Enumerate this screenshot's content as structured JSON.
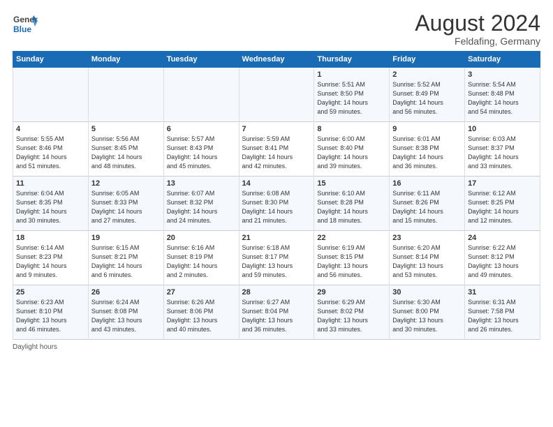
{
  "header": {
    "logo_general": "General",
    "logo_blue": "Blue",
    "month_title": "August 2024",
    "subtitle": "Feldafing, Germany"
  },
  "footer": {
    "note": "Daylight hours"
  },
  "days_of_week": [
    "Sunday",
    "Monday",
    "Tuesday",
    "Wednesday",
    "Thursday",
    "Friday",
    "Saturday"
  ],
  "weeks": [
    {
      "cells": [
        {
          "day": "",
          "info": ""
        },
        {
          "day": "",
          "info": ""
        },
        {
          "day": "",
          "info": ""
        },
        {
          "day": "",
          "info": ""
        },
        {
          "day": "1",
          "info": "Sunrise: 5:51 AM\nSunset: 8:50 PM\nDaylight: 14 hours\nand 59 minutes."
        },
        {
          "day": "2",
          "info": "Sunrise: 5:52 AM\nSunset: 8:49 PM\nDaylight: 14 hours\nand 56 minutes."
        },
        {
          "day": "3",
          "info": "Sunrise: 5:54 AM\nSunset: 8:48 PM\nDaylight: 14 hours\nand 54 minutes."
        }
      ]
    },
    {
      "cells": [
        {
          "day": "4",
          "info": "Sunrise: 5:55 AM\nSunset: 8:46 PM\nDaylight: 14 hours\nand 51 minutes."
        },
        {
          "day": "5",
          "info": "Sunrise: 5:56 AM\nSunset: 8:45 PM\nDaylight: 14 hours\nand 48 minutes."
        },
        {
          "day": "6",
          "info": "Sunrise: 5:57 AM\nSunset: 8:43 PM\nDaylight: 14 hours\nand 45 minutes."
        },
        {
          "day": "7",
          "info": "Sunrise: 5:59 AM\nSunset: 8:41 PM\nDaylight: 14 hours\nand 42 minutes."
        },
        {
          "day": "8",
          "info": "Sunrise: 6:00 AM\nSunset: 8:40 PM\nDaylight: 14 hours\nand 39 minutes."
        },
        {
          "day": "9",
          "info": "Sunrise: 6:01 AM\nSunset: 8:38 PM\nDaylight: 14 hours\nand 36 minutes."
        },
        {
          "day": "10",
          "info": "Sunrise: 6:03 AM\nSunset: 8:37 PM\nDaylight: 14 hours\nand 33 minutes."
        }
      ]
    },
    {
      "cells": [
        {
          "day": "11",
          "info": "Sunrise: 6:04 AM\nSunset: 8:35 PM\nDaylight: 14 hours\nand 30 minutes."
        },
        {
          "day": "12",
          "info": "Sunrise: 6:05 AM\nSunset: 8:33 PM\nDaylight: 14 hours\nand 27 minutes."
        },
        {
          "day": "13",
          "info": "Sunrise: 6:07 AM\nSunset: 8:32 PM\nDaylight: 14 hours\nand 24 minutes."
        },
        {
          "day": "14",
          "info": "Sunrise: 6:08 AM\nSunset: 8:30 PM\nDaylight: 14 hours\nand 21 minutes."
        },
        {
          "day": "15",
          "info": "Sunrise: 6:10 AM\nSunset: 8:28 PM\nDaylight: 14 hours\nand 18 minutes."
        },
        {
          "day": "16",
          "info": "Sunrise: 6:11 AM\nSunset: 8:26 PM\nDaylight: 14 hours\nand 15 minutes."
        },
        {
          "day": "17",
          "info": "Sunrise: 6:12 AM\nSunset: 8:25 PM\nDaylight: 14 hours\nand 12 minutes."
        }
      ]
    },
    {
      "cells": [
        {
          "day": "18",
          "info": "Sunrise: 6:14 AM\nSunset: 8:23 PM\nDaylight: 14 hours\nand 9 minutes."
        },
        {
          "day": "19",
          "info": "Sunrise: 6:15 AM\nSunset: 8:21 PM\nDaylight: 14 hours\nand 6 minutes."
        },
        {
          "day": "20",
          "info": "Sunrise: 6:16 AM\nSunset: 8:19 PM\nDaylight: 14 hours\nand 2 minutes."
        },
        {
          "day": "21",
          "info": "Sunrise: 6:18 AM\nSunset: 8:17 PM\nDaylight: 13 hours\nand 59 minutes."
        },
        {
          "day": "22",
          "info": "Sunrise: 6:19 AM\nSunset: 8:15 PM\nDaylight: 13 hours\nand 56 minutes."
        },
        {
          "day": "23",
          "info": "Sunrise: 6:20 AM\nSunset: 8:14 PM\nDaylight: 13 hours\nand 53 minutes."
        },
        {
          "day": "24",
          "info": "Sunrise: 6:22 AM\nSunset: 8:12 PM\nDaylight: 13 hours\nand 49 minutes."
        }
      ]
    },
    {
      "cells": [
        {
          "day": "25",
          "info": "Sunrise: 6:23 AM\nSunset: 8:10 PM\nDaylight: 13 hours\nand 46 minutes."
        },
        {
          "day": "26",
          "info": "Sunrise: 6:24 AM\nSunset: 8:08 PM\nDaylight: 13 hours\nand 43 minutes."
        },
        {
          "day": "27",
          "info": "Sunrise: 6:26 AM\nSunset: 8:06 PM\nDaylight: 13 hours\nand 40 minutes."
        },
        {
          "day": "28",
          "info": "Sunrise: 6:27 AM\nSunset: 8:04 PM\nDaylight: 13 hours\nand 36 minutes."
        },
        {
          "day": "29",
          "info": "Sunrise: 6:29 AM\nSunset: 8:02 PM\nDaylight: 13 hours\nand 33 minutes."
        },
        {
          "day": "30",
          "info": "Sunrise: 6:30 AM\nSunset: 8:00 PM\nDaylight: 13 hours\nand 30 minutes."
        },
        {
          "day": "31",
          "info": "Sunrise: 6:31 AM\nSunset: 7:58 PM\nDaylight: 13 hours\nand 26 minutes."
        }
      ]
    }
  ]
}
